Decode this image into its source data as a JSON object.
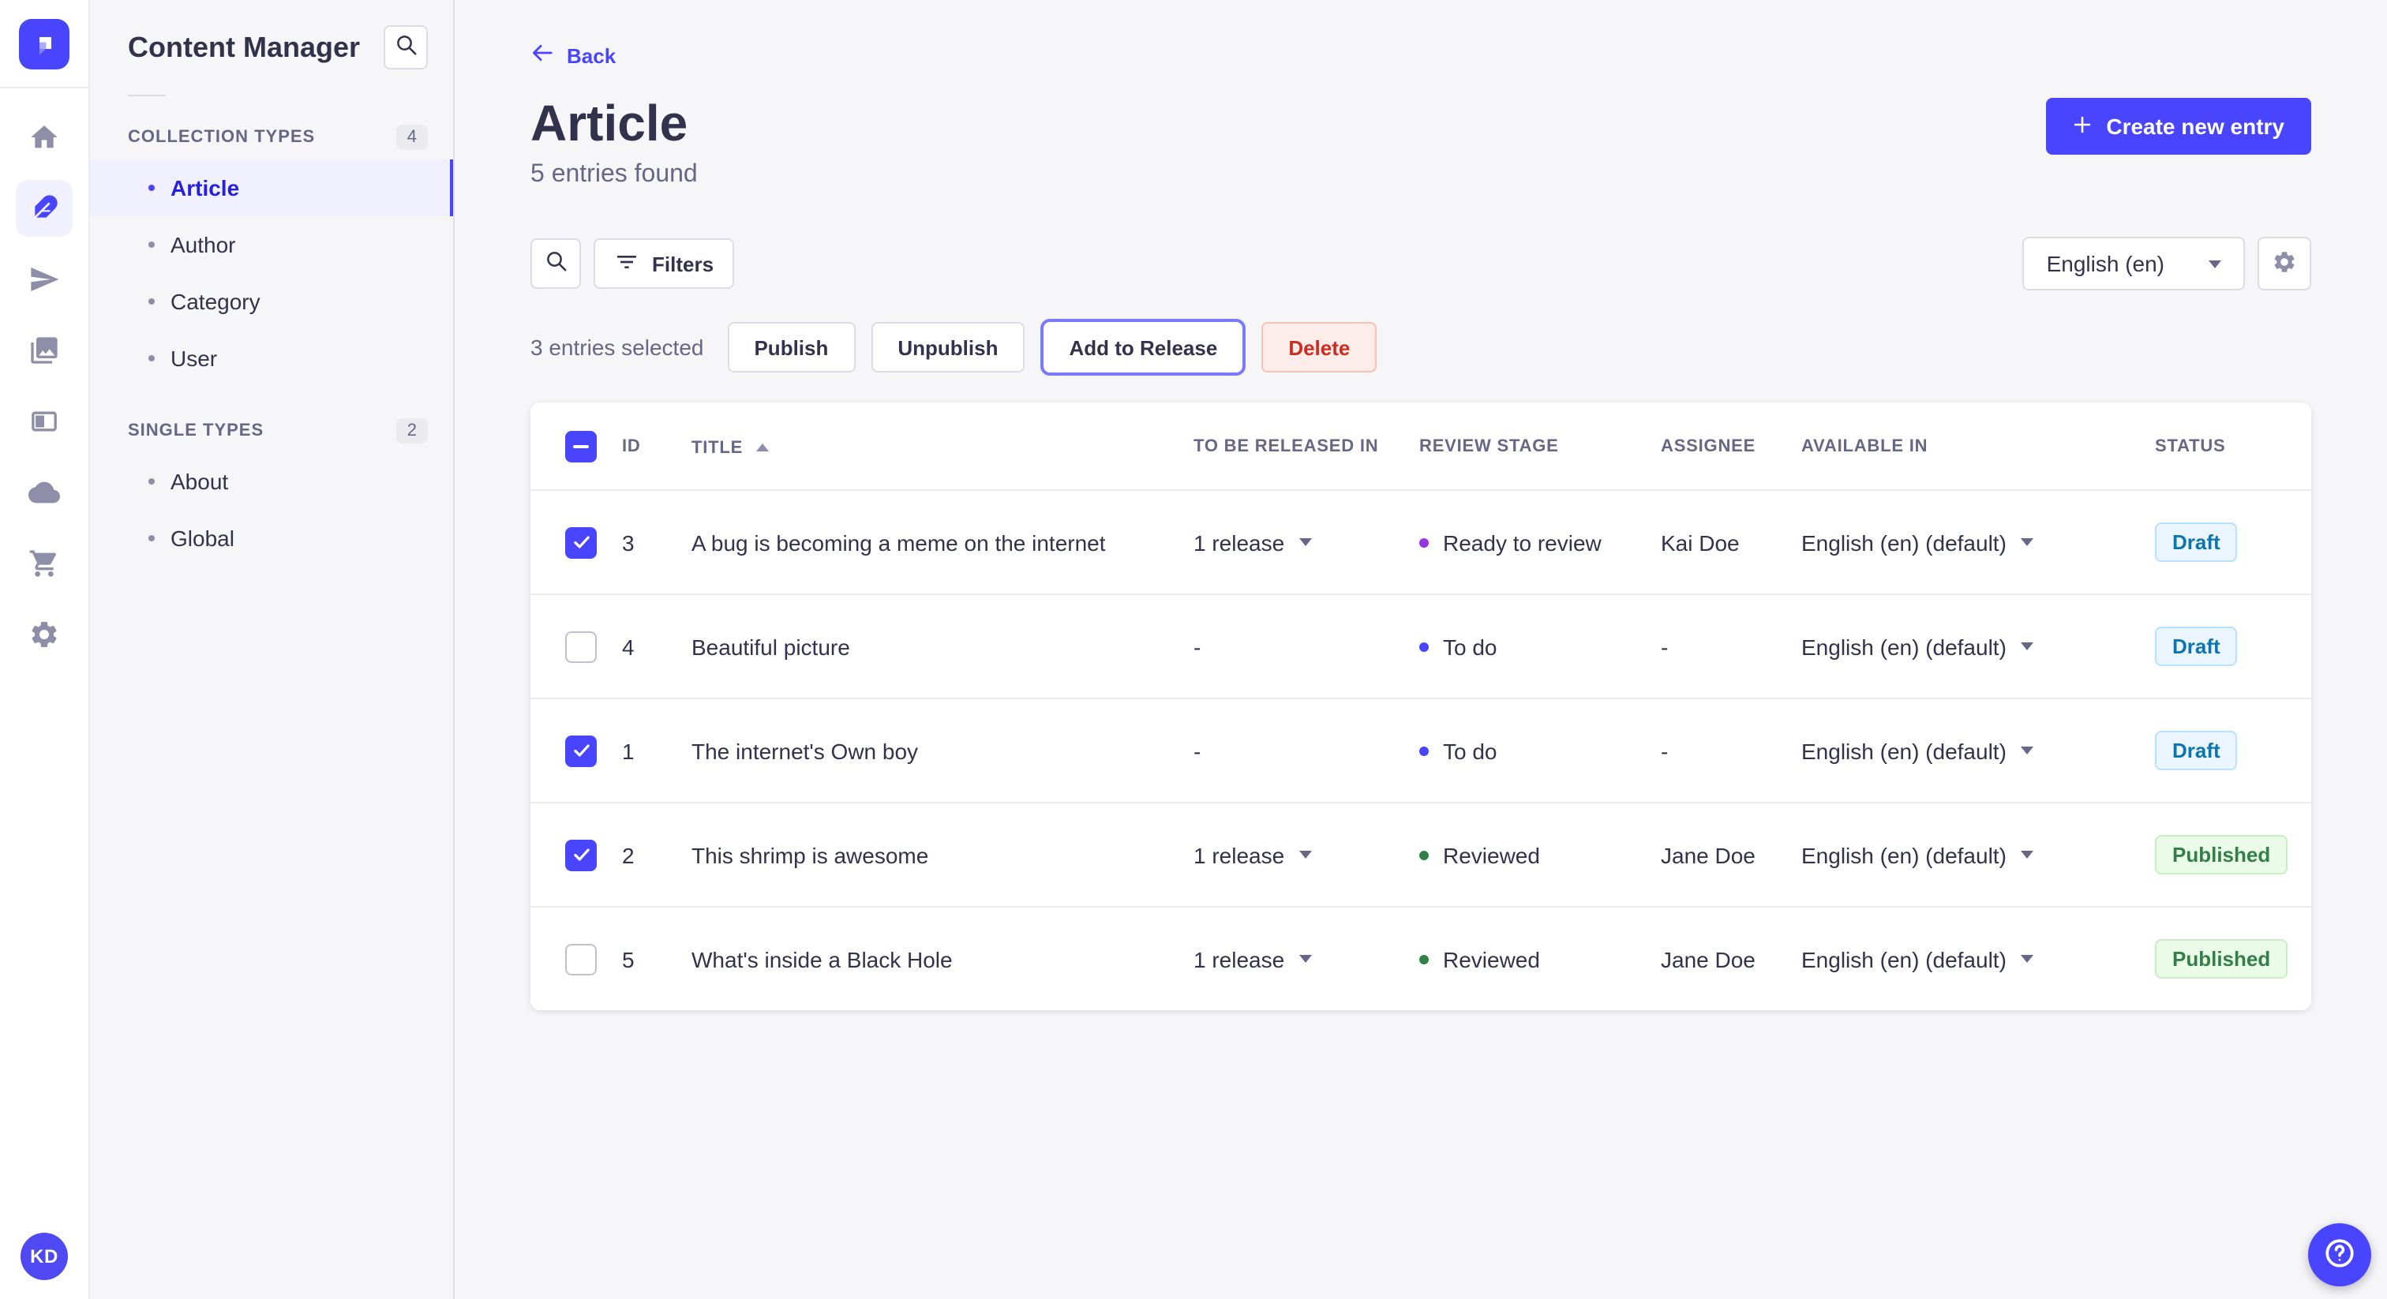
{
  "app": {
    "accent_color": "#4945ff"
  },
  "nav_rail": {
    "logo_icon": "strapi-logo-icon",
    "items": [
      {
        "icon": "home-icon",
        "active": false
      },
      {
        "icon": "feather-icon",
        "active": true
      },
      {
        "icon": "paper-plane-icon",
        "active": false
      },
      {
        "icon": "media-library-icon",
        "active": false
      },
      {
        "icon": "layout-icon",
        "active": false
      },
      {
        "icon": "cloud-icon",
        "active": false
      },
      {
        "icon": "cart-icon",
        "active": false
      },
      {
        "icon": "gear-icon",
        "active": false
      }
    ],
    "avatar_initials": "KD"
  },
  "subnav": {
    "title": "Content Manager",
    "search_icon": "search-icon",
    "sections": [
      {
        "label": "COLLECTION TYPES",
        "badge": "4",
        "items": [
          {
            "label": "Article",
            "active": true
          },
          {
            "label": "Author",
            "active": false
          },
          {
            "label": "Category",
            "active": false
          },
          {
            "label": "User",
            "active": false
          }
        ]
      },
      {
        "label": "SINGLE TYPES",
        "badge": "2",
        "items": [
          {
            "label": "About",
            "active": false
          },
          {
            "label": "Global",
            "active": false
          }
        ]
      }
    ]
  },
  "header": {
    "back_icon": "arrow-left-icon",
    "back_label": "Back",
    "title": "Article",
    "subtitle": "5 entries found",
    "create_icon": "plus-icon",
    "create_button_label": "Create new entry"
  },
  "toolbar": {
    "search_icon": "search-icon",
    "filter_icon": "filter-icon",
    "filters_label": "Filters",
    "locale_selected": "English (en)",
    "settings_icon": "gear-small-icon"
  },
  "selection_bar": {
    "selected_text": "3 entries selected",
    "publish_label": "Publish",
    "unpublish_label": "Unpublish",
    "add_to_release_label": "Add to Release",
    "delete_label": "Delete"
  },
  "table": {
    "columns": [
      "ID",
      "TITLE",
      "TO BE RELEASED IN",
      "REVIEW STAGE",
      "ASSIGNEE",
      "AVAILABLE IN",
      "STATUS"
    ],
    "sorted_column": "TITLE",
    "sort_direction": "asc",
    "rows": [
      {
        "checked": true,
        "id": "3",
        "title": "A bug is becoming a meme on the internet",
        "to_be_released_in": "1 release",
        "review_stage": "Ready to review",
        "stage_color": "#9736e8",
        "assignee": "Kai Doe",
        "available_in": "English (en) (default)",
        "status": "Draft"
      },
      {
        "checked": false,
        "id": "4",
        "title": "Beautiful picture",
        "to_be_released_in": "-",
        "review_stage": "To do",
        "stage_color": "#4945ff",
        "assignee": "-",
        "available_in": "English (en) (default)",
        "status": "Draft"
      },
      {
        "checked": true,
        "id": "1",
        "title": "The internet's Own boy",
        "to_be_released_in": "-",
        "review_stage": "To do",
        "stage_color": "#4945ff",
        "assignee": "-",
        "available_in": "English (en) (default)",
        "status": "Draft"
      },
      {
        "checked": true,
        "id": "2",
        "title": "This shrimp is awesome",
        "to_be_released_in": "1 release",
        "review_stage": "Reviewed",
        "stage_color": "#328048",
        "assignee": "Jane Doe",
        "available_in": "English (en) (default)",
        "status": "Published"
      },
      {
        "checked": false,
        "id": "5",
        "title": "What's inside a Black Hole",
        "to_be_released_in": "1 release",
        "review_stage": "Reviewed",
        "stage_color": "#328048",
        "assignee": "Jane Doe",
        "available_in": "English (en) (default)",
        "status": "Published"
      }
    ],
    "status_styles": {
      "Draft": {
        "bg": "#eaf5ff",
        "border": "#b8e1ff",
        "text": "#0c75af"
      },
      "Published": {
        "bg": "#eafbe7",
        "border": "#c6f0c2",
        "text": "#328048"
      }
    }
  },
  "help": {
    "icon": "question-circle-icon"
  }
}
